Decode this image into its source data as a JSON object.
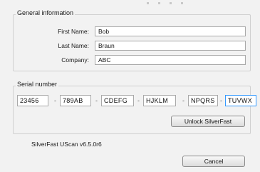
{
  "general": {
    "title": "General information",
    "first_name_label": "First Name:",
    "first_name_value": "Bob",
    "last_name_label": "Last Name:",
    "last_name_value": "Braun",
    "company_label": "Company:",
    "company_value": "ABC"
  },
  "serial": {
    "title": "Serial number",
    "parts": [
      "23456",
      "789AB",
      "CDEFG",
      "HJKLM",
      "NPQRS",
      "TUVWX"
    ],
    "separator": "-"
  },
  "buttons": {
    "unlock_label": "Unlock SilverFast",
    "cancel_label": "Cancel"
  },
  "version_text": "SilverFast UScan v6.5.0r6"
}
